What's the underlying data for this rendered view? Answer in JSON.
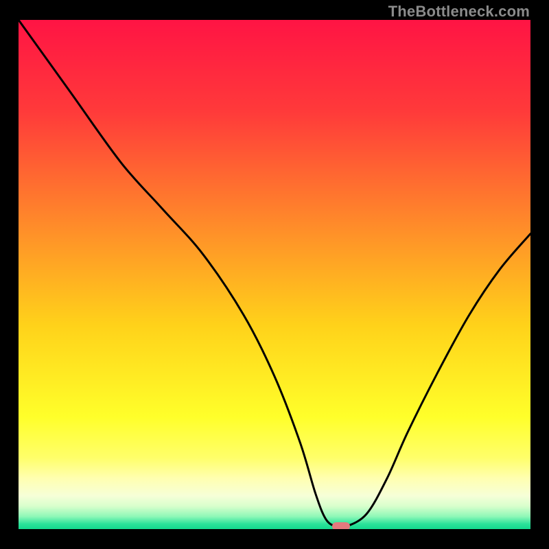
{
  "watermark": "TheBottleneck.com",
  "chart_data": {
    "type": "line",
    "title": "",
    "xlabel": "",
    "ylabel": "",
    "xlim": [
      0,
      100
    ],
    "ylim": [
      0,
      100
    ],
    "x": [
      0,
      10,
      20,
      28,
      36,
      44,
      50,
      55,
      58,
      60,
      62,
      64,
      68,
      72,
      76,
      82,
      88,
      94,
      100
    ],
    "values": [
      100,
      86,
      72,
      63,
      54,
      42,
      30,
      17,
      7,
      2,
      0.5,
      0.5,
      3,
      10,
      19,
      31,
      42,
      51,
      58
    ],
    "marker": {
      "x": 63,
      "y": 0.5
    },
    "gradient_stops": [
      {
        "offset": 0.0,
        "color": "#ff1444"
      },
      {
        "offset": 0.18,
        "color": "#ff3a3a"
      },
      {
        "offset": 0.4,
        "color": "#ff8a2a"
      },
      {
        "offset": 0.6,
        "color": "#ffd21a"
      },
      {
        "offset": 0.78,
        "color": "#ffff2a"
      },
      {
        "offset": 0.86,
        "color": "#ffff6a"
      },
      {
        "offset": 0.9,
        "color": "#ffffb0"
      },
      {
        "offset": 0.935,
        "color": "#f6ffd8"
      },
      {
        "offset": 0.955,
        "color": "#d8ffcc"
      },
      {
        "offset": 0.975,
        "color": "#90f8b8"
      },
      {
        "offset": 0.99,
        "color": "#2be39a"
      },
      {
        "offset": 1.0,
        "color": "#14d98d"
      }
    ]
  }
}
